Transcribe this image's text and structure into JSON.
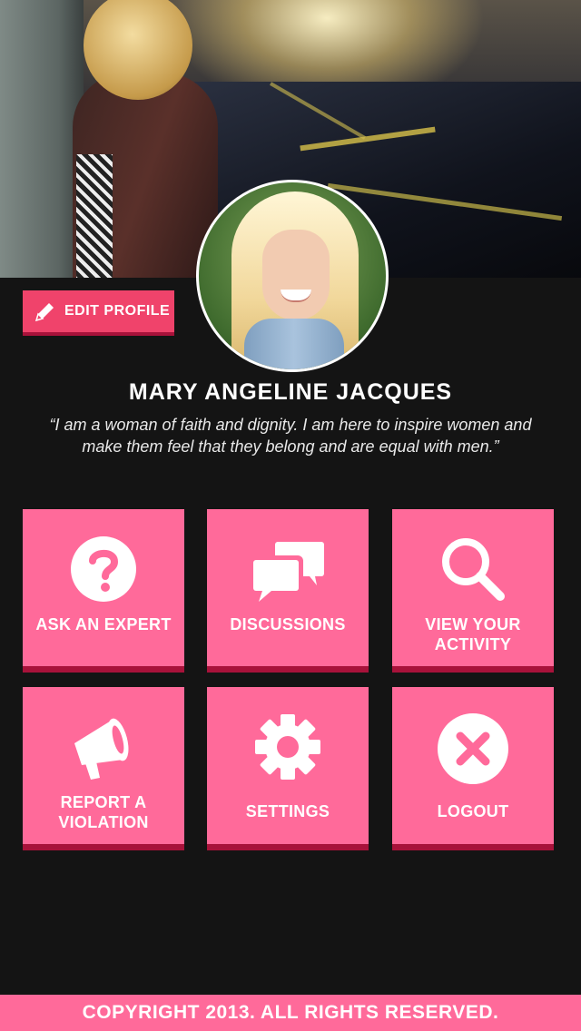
{
  "profile": {
    "name": "MARY ANGELINE JACQUES",
    "bio": "“I am a woman of faith and dignity. I am here to inspire women and make them feel that they belong and are equal with men.”",
    "edit_label": "EDIT PROFILE"
  },
  "tiles": [
    {
      "label": "ASK AN EXPERT",
      "icon": "question-icon"
    },
    {
      "label": "DISCUSSIONS",
      "icon": "chat-bubbles-icon"
    },
    {
      "label": "VIEW YOUR ACTIVITY",
      "icon": "search-icon"
    },
    {
      "label": "REPORT A VIOLATION",
      "icon": "megaphone-icon"
    },
    {
      "label": "SETTINGS",
      "icon": "gear-icon"
    },
    {
      "label": "LOGOUT",
      "icon": "close-circle-icon"
    }
  ],
  "footer": {
    "text": "COPYRIGHT 2013. ALL RIGHTS RESERVED."
  },
  "colors": {
    "accent": "#ff6a9a",
    "accent_dark": "#a8123a",
    "edit_button": "#f0436b",
    "background": "#141414"
  }
}
